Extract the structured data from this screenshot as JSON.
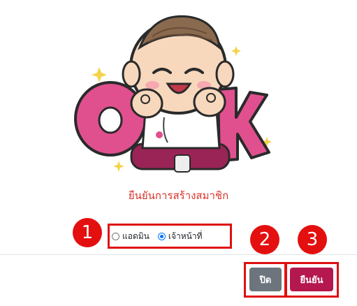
{
  "dialog": {
    "title": "ยืนยันการสร้างสมาชิก",
    "role_options": [
      {
        "label": "แอดมิน",
        "checked": false
      },
      {
        "label": "เจ้าหน้าที่",
        "checked": true
      }
    ],
    "close_label": "ปิด",
    "confirm_label": "ยืนยัน"
  },
  "illustration": {
    "icon": "ok-sticker-character-icon",
    "letters": "OK"
  },
  "annotations": {
    "badges": [
      "1",
      "2",
      "3"
    ]
  },
  "colors": {
    "title": "#d9342b",
    "confirm_button": "#b5174f",
    "close_button": "#6c757d",
    "annotation": "#e40f0f",
    "ok_letters": "#e0508e"
  }
}
